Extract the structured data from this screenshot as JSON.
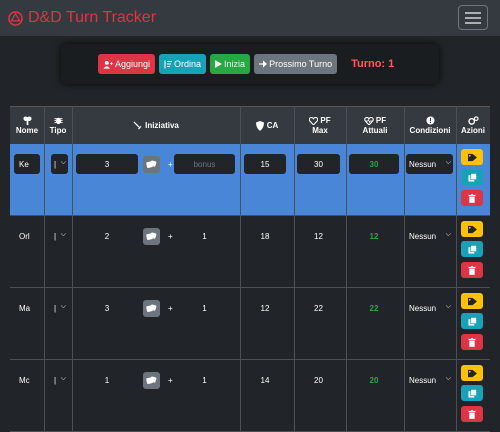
{
  "app": {
    "title": "D&D Turn Tracker"
  },
  "controls": {
    "add_label": "Aggiungi",
    "sort_label": "Ordina",
    "start_label": "Inizia",
    "next_label": "Prossimo Turno",
    "turn_label": "Turno: 1"
  },
  "table": {
    "headers": {
      "name": "Nome",
      "type": "Tipo",
      "initiative": "Iniziativa",
      "ac": "CA",
      "hp_max_1": "PF",
      "hp_max_2": "Max",
      "hp_cur_1": "PF",
      "hp_cur_2": "Attuali",
      "conditions": "Condizioni",
      "actions": "Azioni"
    },
    "rows": [
      {
        "name": "Ke",
        "type": "|",
        "roll": "3",
        "bonus": "",
        "bonus_placeholder": "bonus",
        "plus": "+",
        "ac": "15",
        "hp_max": "30",
        "hp_current": "30",
        "condition": "Nessun",
        "active": true
      },
      {
        "name": "Orl",
        "type": "|",
        "roll": "2",
        "bonus": "1",
        "bonus_placeholder": "",
        "plus": "+",
        "ac": "18",
        "hp_max": "12",
        "hp_current": "12",
        "condition": "Nessun",
        "active": false
      },
      {
        "name": "Ma",
        "type": "|",
        "roll": "3",
        "bonus": "1",
        "bonus_placeholder": "",
        "plus": "+",
        "ac": "12",
        "hp_max": "22",
        "hp_current": "22",
        "condition": "Nessun",
        "active": false
      },
      {
        "name": "Mc",
        "type": "|",
        "roll": "1",
        "bonus": "1",
        "bonus_placeholder": "",
        "plus": "+",
        "ac": "14",
        "hp_max": "20",
        "hp_current": "20",
        "condition": "Nessun",
        "active": false
      }
    ]
  },
  "colors": {
    "accent_red": "#dc3545",
    "active_row": "#4a86d8",
    "hp_green": "#28a745"
  }
}
